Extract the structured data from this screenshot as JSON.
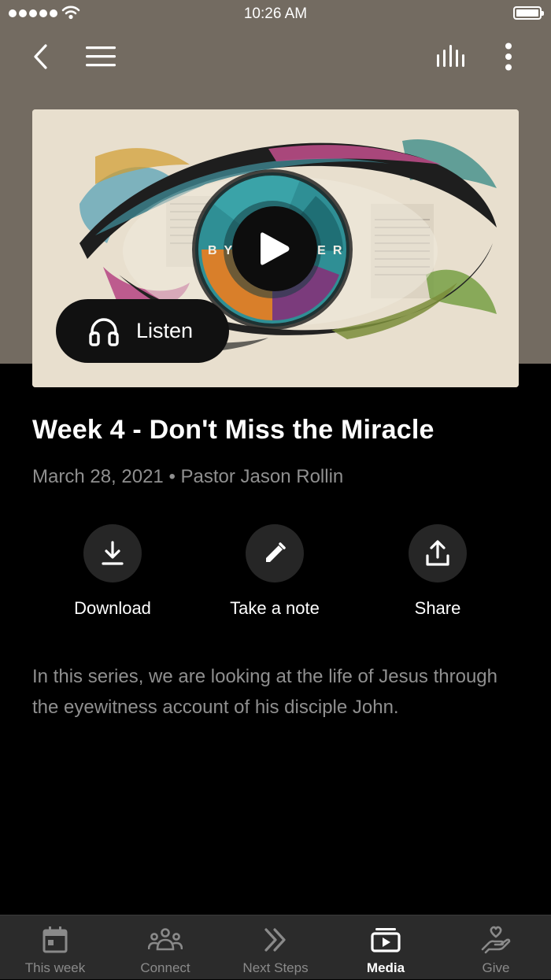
{
  "status_bar": {
    "time": "10:26 AM"
  },
  "nav": {
    "icons": {
      "back": "chevron-left-icon",
      "menu": "hamburger-menu-icon",
      "audio": "audio-bars-icon",
      "more": "more-vertical-icon"
    }
  },
  "hero": {
    "series_title": "BYSTANDER",
    "listen_label": "Listen"
  },
  "sermon": {
    "title": "Week 4 - Don't Miss the Miracle",
    "meta": "March 28, 2021 • Pastor Jason Rollin",
    "description": "In this series, we are looking at the life of Jesus through the eyewitness account of his disciple John."
  },
  "actions": [
    {
      "label": "Download",
      "icon": "download-icon"
    },
    {
      "label": "Take a note",
      "icon": "pencil-icon"
    },
    {
      "label": "Share",
      "icon": "share-icon"
    }
  ],
  "tabs": [
    {
      "label": "This week",
      "icon": "calendar-icon",
      "active": false
    },
    {
      "label": "Connect",
      "icon": "people-icon",
      "active": false
    },
    {
      "label": "Next Steps",
      "icon": "double-chevron-right-icon",
      "active": false
    },
    {
      "label": "Media",
      "icon": "media-play-icon",
      "active": true
    },
    {
      "label": "Give",
      "icon": "hand-heart-icon",
      "active": false
    }
  ],
  "colors": {
    "header_bg": "#736b61",
    "background": "#000000",
    "tabbar_bg": "#2b2b2b",
    "muted_text": "#8f8f8f"
  }
}
